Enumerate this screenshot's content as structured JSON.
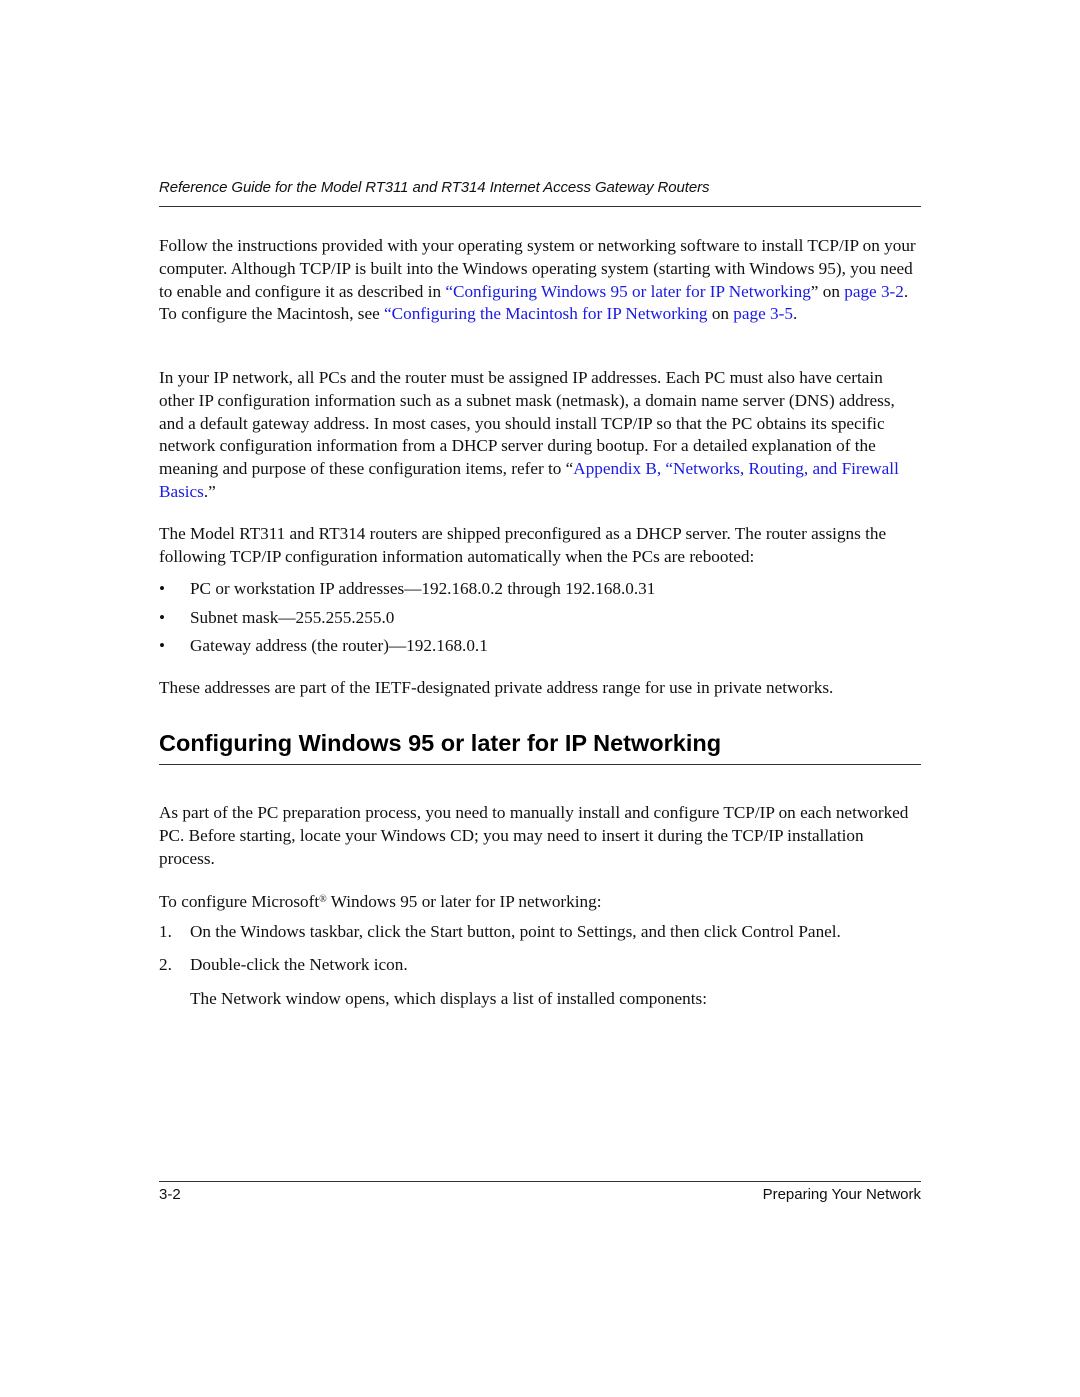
{
  "header": {
    "running_title": "Reference Guide for the Model RT311 and RT314 Internet Access Gateway Routers"
  },
  "intro": {
    "p1_a": "Follow the instructions provided with your operating system or networking software to install TCP/IP on your computer. Although TCP/IP is built into the Windows operating system (starting with Windows 95), you need to enable and configure it as described in ",
    "p1_link1": "“Configuring Windows 95 or later for IP Networking",
    "p1_b": "” on ",
    "p1_link2": "page 3-2",
    "p1_c": ". To configure the Macintosh, see ",
    "p1_link3": "“Configuring the Macintosh for IP Networking",
    "p1_d": " on ",
    "p1_link4": "page 3-5",
    "p1_e": ".",
    "p2_a": "In your IP network, all PCs and the router must be assigned IP addresses. Each PC must also have certain other IP configuration information such as a subnet mask (netmask), a domain name server (DNS) address, and a default gateway address. In most cases, you should install TCP/IP so that the PC obtains its specific network configuration information from a DHCP server during bootup. For a detailed explanation of the meaning and purpose of these configuration items, refer to “",
    "p2_link": "Appendix B, “Networks, Routing, and Firewall Basics",
    "p2_b": ".”",
    "p3": "The Model RT311 and RT314 routers are shipped preconfigured as a DHCP server. The router assigns the following TCP/IP configuration information automatically when the PCs are rebooted:",
    "bullet_glyph": "•",
    "bullets": [
      "PC or workstation IP addresses—192.168.0.2 through 192.168.0.31",
      "Subnet mask—255.255.255.0",
      "Gateway address (the router)—192.168.0.1"
    ],
    "p4": "These addresses are part of the IETF-designated private address range for use in private networks."
  },
  "section": {
    "title": "Configuring Windows 95 or later for IP Networking",
    "p5": "As part of the PC preparation process, you need to manually install and configure TCP/IP on each networked PC. Before starting, locate your Windows CD; you may need to insert it during the TCP/IP installation process.",
    "p6_a": "To configure Microsoft",
    "p6_sup": "®",
    "p6_b": " Windows 95 or later for IP networking:",
    "steps": [
      {
        "num": "1.",
        "text": "On the Windows taskbar, click the Start button, point to Settings, and then click Control Panel."
      },
      {
        "num": "2.",
        "text": "Double-click the Network icon."
      }
    ],
    "p7": "The Network window opens, which displays a list of installed components:"
  },
  "footer": {
    "page_number": "3-2",
    "chapter": "Preparing Your Network"
  },
  "colors": {
    "link": "#1a1ae6",
    "text": "#111111"
  }
}
